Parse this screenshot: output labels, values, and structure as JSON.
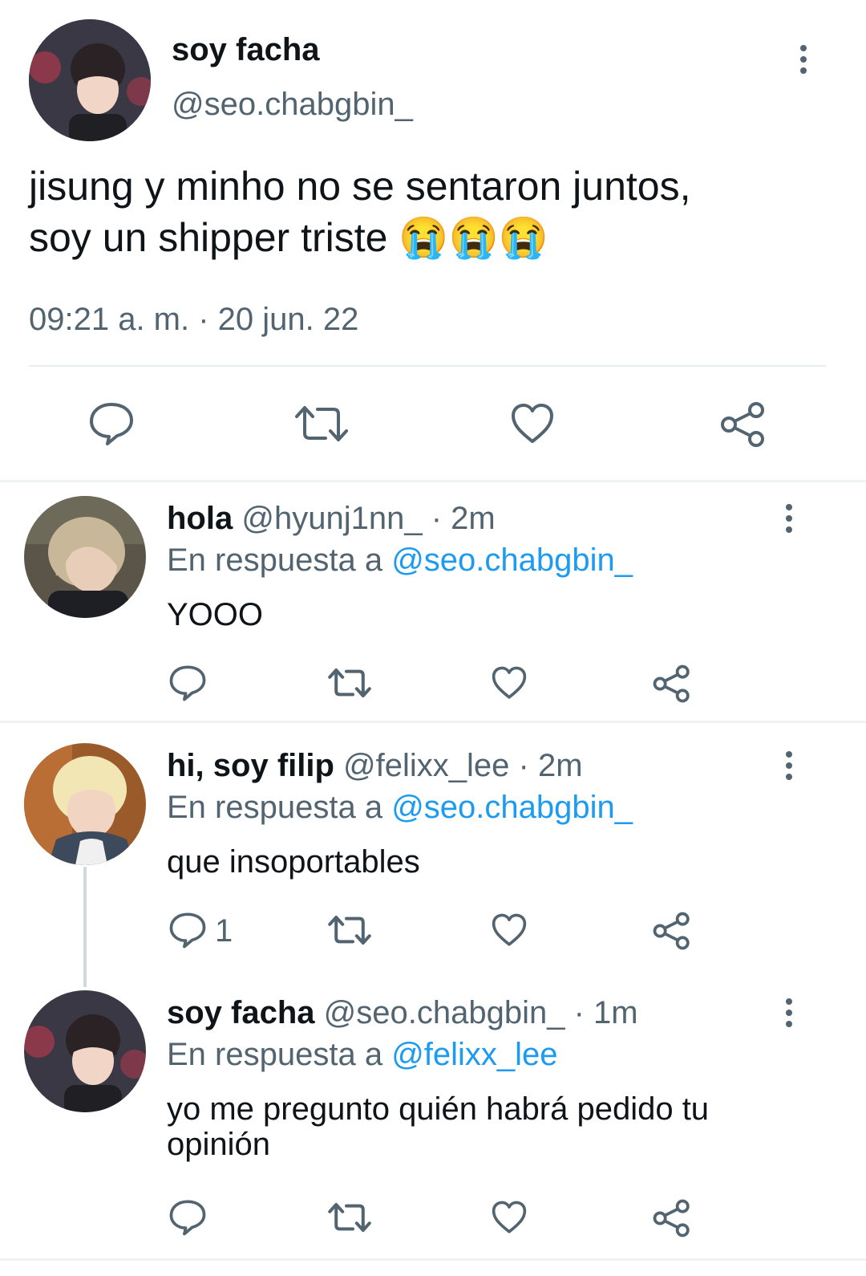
{
  "main_tweet": {
    "display_name": "soy facha",
    "handle": "@seo.chabgbin_",
    "text_line1": "jisung y minho no se sentaron juntos,",
    "text_line2": "soy un shipper triste",
    "emojis": "😭😭😭",
    "timestamp": "09:21 a. m. · 20 jun. 22",
    "icons": [
      "reply-icon",
      "retweet-icon",
      "like-icon",
      "share-icon"
    ]
  },
  "replies": [
    {
      "display_name": "hola",
      "handle": "@hyunj1nn_",
      "time": "· 2m",
      "reply_prefix": "En respuesta a",
      "reply_to": "@seo.chabgbin_",
      "text": "YOOO",
      "reply_count": ""
    },
    {
      "display_name": "hi, soy filip",
      "handle": "@felixx_lee",
      "time": "· 2m",
      "reply_prefix": "En respuesta a",
      "reply_to": "@seo.chabgbin_",
      "text": "que insoportables",
      "reply_count": "1"
    },
    {
      "display_name": "soy facha",
      "handle": "@seo.chabgbin_",
      "time": "· 1m",
      "reply_prefix": "En respuesta a",
      "reply_to": "@felixx_lee",
      "text_line1": "yo me pregunto quién habrá pedido tu",
      "text_line2": "opinión",
      "reply_count": ""
    }
  ],
  "colors": {
    "text": "#0f1419",
    "secondary": "#536471",
    "link": "#1d9bf0"
  }
}
